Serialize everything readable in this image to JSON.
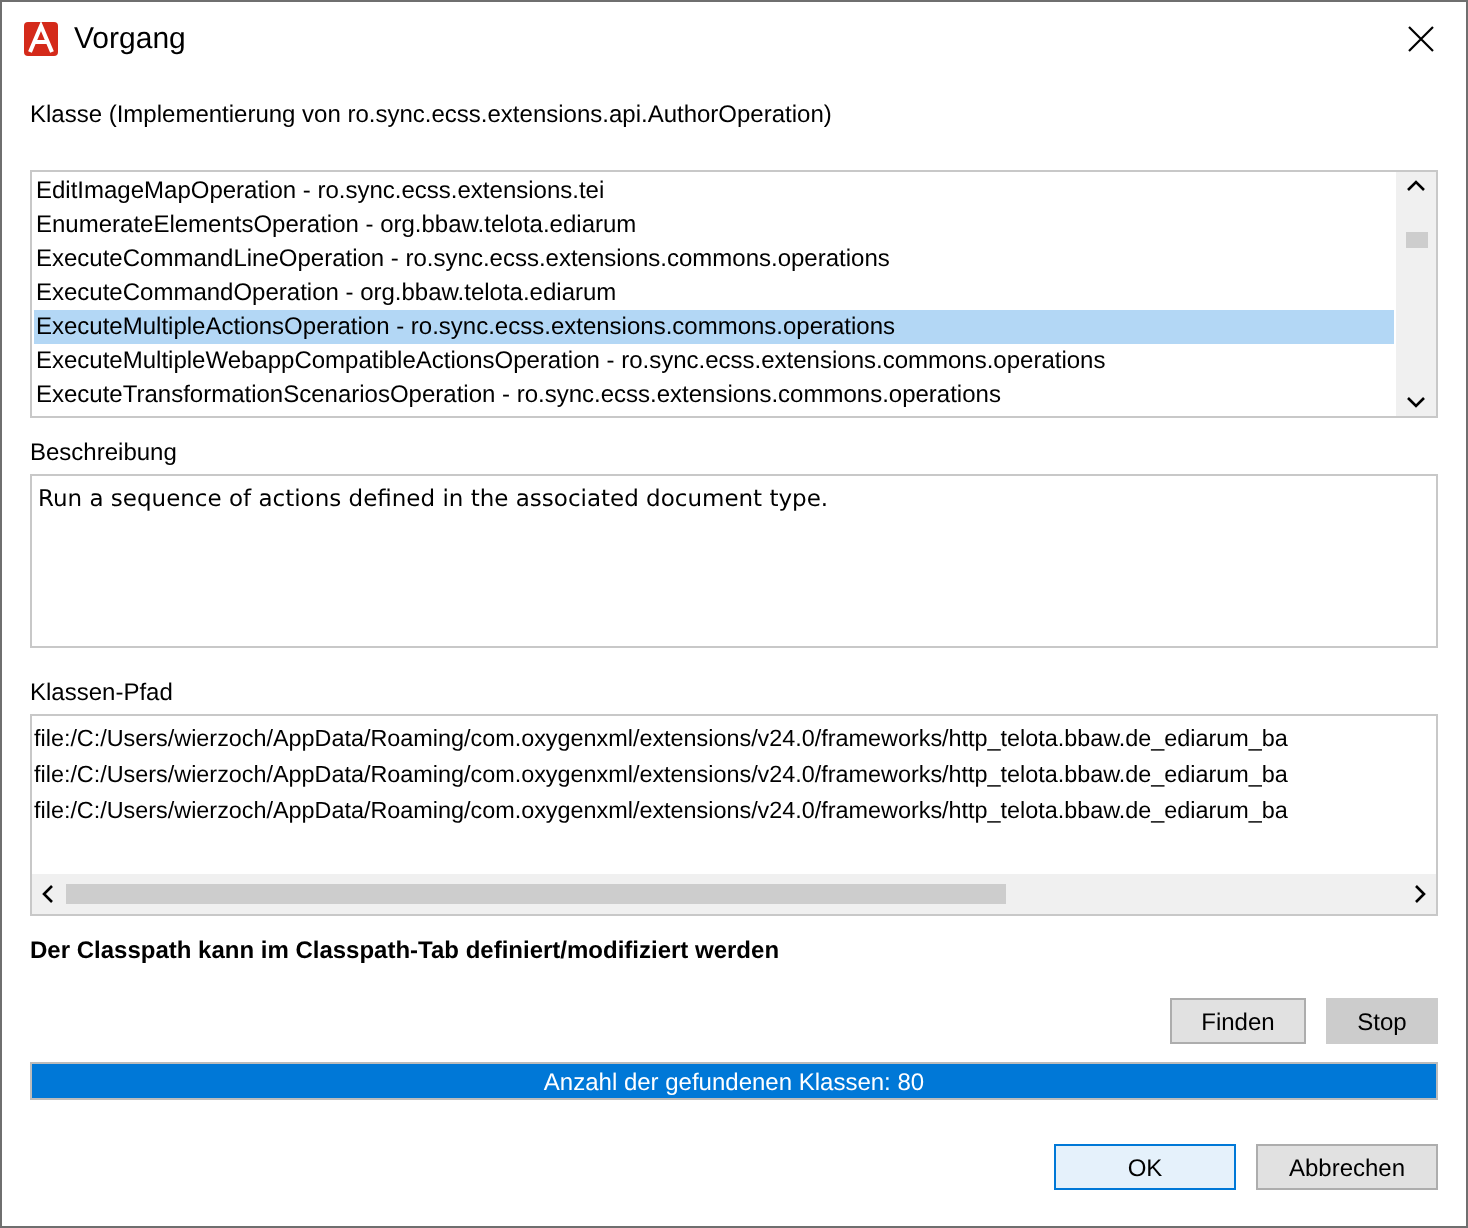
{
  "window": {
    "title": "Vorgang"
  },
  "class_label": "Klasse (Implementierung von ro.sync.ecss.extensions.api.AuthorOperation)",
  "classes": [
    {
      "text": "EditImageMapOperation - ro.sync.ecss.extensions.tei",
      "selected": false
    },
    {
      "text": "EnumerateElementsOperation - org.bbaw.telota.ediarum",
      "selected": false
    },
    {
      "text": "ExecuteCommandLineOperation - ro.sync.ecss.extensions.commons.operations",
      "selected": false
    },
    {
      "text": "ExecuteCommandOperation - org.bbaw.telota.ediarum",
      "selected": false
    },
    {
      "text": "ExecuteMultipleActionsOperation - ro.sync.ecss.extensions.commons.operations",
      "selected": true
    },
    {
      "text": "ExecuteMultipleWebappCompatibleActionsOperation - ro.sync.ecss.extensions.commons.operations",
      "selected": false
    },
    {
      "text": "ExecuteTransformationScenariosOperation - ro.sync.ecss.extensions.commons.operations",
      "selected": false
    }
  ],
  "description_label": "Beschreibung",
  "description": "Run a sequence of actions defined in the associated document type.",
  "classpath_label": "Klassen-Pfad",
  "classpath": [
    "file:/C:/Users/wierzoch/AppData/Roaming/com.oxygenxml/extensions/v24.0/frameworks/http_telota.bbaw.de_ediarum_ba",
    "file:/C:/Users/wierzoch/AppData/Roaming/com.oxygenxml/extensions/v24.0/frameworks/http_telota.bbaw.de_ediarum_ba",
    "file:/C:/Users/wierzoch/AppData/Roaming/com.oxygenxml/extensions/v24.0/frameworks/http_telota.bbaw.de_ediarum_ba"
  ],
  "note": "Der Classpath kann im Classpath-Tab definiert/modifiziert werden",
  "search_buttons": [
    {
      "label": "Finden",
      "pressed": false
    },
    {
      "label": "Stop",
      "pressed": true
    }
  ],
  "progress": {
    "text": "Anzahl der gefundenen Klassen: 80",
    "level": 1
  },
  "buttons": [
    {
      "label": "OK",
      "default": true
    },
    {
      "label": "Abbrechen",
      "default": false
    }
  ]
}
